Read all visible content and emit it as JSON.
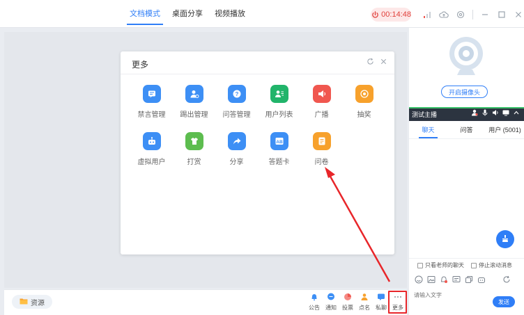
{
  "topbar": {
    "tabs": [
      {
        "label": "文档模式",
        "active": true
      },
      {
        "label": "桌面分享",
        "active": false
      },
      {
        "label": "视频播放",
        "active": false
      }
    ],
    "timer": "00:14:48"
  },
  "dialog": {
    "title": "更多",
    "items": [
      {
        "label": "禁言管理",
        "icon": "mute-manage-icon",
        "color": "#3d8ff5"
      },
      {
        "label": "踢出管理",
        "icon": "kick-user-icon",
        "color": "#3d8ff5"
      },
      {
        "label": "问答管理",
        "icon": "qa-icon",
        "color": "#3d8ff5"
      },
      {
        "label": "用户列表",
        "icon": "user-list-icon",
        "color": "#21b46a"
      },
      {
        "label": "广播",
        "icon": "broadcast-icon",
        "color": "#f0574f"
      },
      {
        "label": "抽奖",
        "icon": "lottery-icon",
        "color": "#f7a12c"
      },
      {
        "label": "虚拟用户",
        "icon": "robot-icon",
        "color": "#3d8ff5"
      },
      {
        "label": "打赏",
        "icon": "gift-icon",
        "color": "#5dbd4f"
      },
      {
        "label": "分享",
        "icon": "share-icon",
        "color": "#3d8ff5"
      },
      {
        "label": "答题卡",
        "icon": "answer-card-icon",
        "color": "#3d8ff5"
      },
      {
        "label": "问卷",
        "icon": "questionnaire-icon",
        "color": "#f7a12c"
      }
    ]
  },
  "bottombar": {
    "resource_label": "资源",
    "tools": [
      {
        "label": "公告",
        "icon": "bell-icon",
        "color": "#3d8ff5"
      },
      {
        "label": "通知",
        "icon": "chat-bubble-icon",
        "color": "#3d8ff5"
      },
      {
        "label": "投票",
        "icon": "pie-chart-icon",
        "color": "#f0574f"
      },
      {
        "label": "点名",
        "icon": "roll-call-icon",
        "color": "#f7a12c"
      },
      {
        "label": "私聊",
        "icon": "private-chat-icon",
        "color": "#3d8ff5"
      },
      {
        "label": "更多",
        "icon": "more-dots-icon",
        "color": "#8a929b"
      }
    ]
  },
  "right_panel": {
    "camera_button": "开启摄像头",
    "host_label": "测试主播",
    "tabs": [
      {
        "label": "聊天",
        "active": true
      },
      {
        "label": "问答",
        "active": false
      },
      {
        "label": "用户 (5001)",
        "active": false
      }
    ],
    "filter_teacher": "只看老师的聊天",
    "filter_scroll": "停止滚动消息",
    "input_placeholder": "请输入文字",
    "send_label": "发送"
  },
  "colors": {
    "accent": "#2f7ef7",
    "timer_red": "#e0403b",
    "highlight_red": "#e8262a"
  }
}
